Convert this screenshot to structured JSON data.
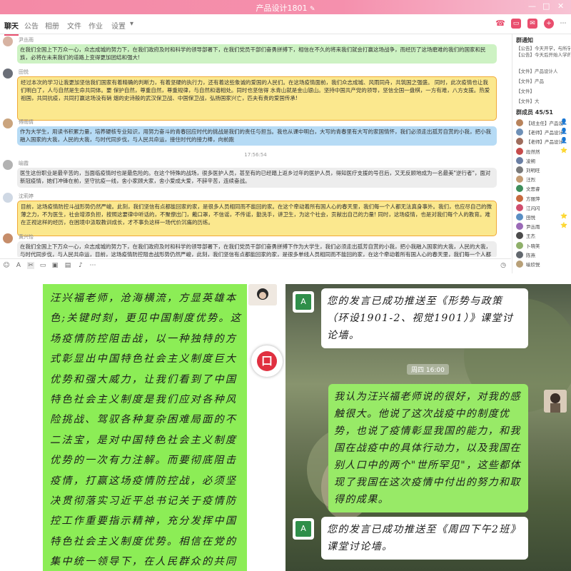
{
  "window": {
    "title": "产品设计1801",
    "edit_icon": "pencil-icon",
    "controls": [
      "—",
      "□",
      "✕"
    ]
  },
  "nav": {
    "tabs": [
      "聊天",
      "公告",
      "相册",
      "文件",
      "作业",
      "设置"
    ],
    "active_tab": "聊天",
    "settings_caret": "▾",
    "accent": "#e94e6e"
  },
  "messages": [
    {
      "name": "尹丛雨",
      "style": "green",
      "text": "在我们全国上下万众一心，众志成城的努力下，在我们政府及时和科学的领导部署下，在我们党员干部们奋勇拼搏下，相信在不久的将来我们就会打赢这场战争，而经历了这场磨难的我们的国家和民族，必将在未来我们的道路上变得更加团结和强大!"
    },
    {
      "name": "田悦",
      "style": "yellow",
      "text": "经过本次的学习让我更加坚信我们国家有着精确的判断力，有着坚硬的执行力，还有着这些象诚的爱国的人民们。在这场疫情面前，我们众志成城、风雨同舟，共筑国之强盛。 同时，此次疫情也让我们明白了，人与自然是生命共同体。要 保护自然，尊重自然，尊重规律，与自然和谐相处。同时也坚信得 水青山就是金山银山。坚持中国共产党的领导，坚信全国一盘棋，一方有难，八方支援。热爱祖国，共同抗疫，共同打赢这场没有硝 烟的史诗般的武汉保卫战、中国保卫战，弘扬国家兴亡，匹夫有责的爱国传承!"
    },
    {
      "name": "傅雨倩",
      "style": "blue",
      "text": "作为大学生，用读书积累力量，培养硬核专业知识，用努力奋斗的青春回应时代的挑战是我们的责任与担当。我也从课中明白，大写的青春里有大写的家国情怀，我们必须走出孤芳自赏的小我，把小我融入国家的大我，人民的大我，与时代同步伐，与人民共命运，接住时代的接力棒，向前跑"
    },
    {
      "name": "喻霞",
      "style": "gray",
      "text": "医生这份职业是最辛苦的，当面临疫情时也是最危险的。在这个特殊的战场，很多医护人员，甚至有的已经踏上返乡过年的医护人员，得知医疗支援的号召后，又无反顾地成为一名最美\"逆行者\"，面对新冠疫情，她们冲锋在前，坚守抗疫一线，舍小家顾大家，舍小爱成大爱，不辞辛苦，连续奋战。"
    },
    {
      "name": "沈莉婷",
      "style": "yellow",
      "text": "目前，这场疫情防控斗战形势仍然严峻。此刻，我们坚信有点都能回家的家，是很多人员相同而不能回的家。在这个牵动着所有国人心的春天里，我们每一个人都无法真身事外。我们，也应尽自己的微薄之力，不为医生，社会增添负担，按照这要律中听话的，不聚僚出门，戴口罩，不信谣，不传谣，勤洗手，讲卫生，为这个社会，贡献出自己的力量! 同时，这场疫情，也是对我们每个人的教育。难在正视这样的经历，在困境中汲取教训成长，才不事负这样一场代价沉痛的历练。"
    },
    {
      "name": "黄兴怡",
      "style": "gray",
      "text": "在我们全国上下万众一心，众志成城的努力下，在我们政府及时和科学的领导部署下，在我们党员干部们奋勇拼搏下作为大学生，我们必须走出孤芳自赏的小我，把小我融入国家的大我，人民的大我，与时代同步伐，与人民共命运，目前，这场疫情防控阻击战形势仍然严峻，此刻，我们坚信有点都能回家的家，是很多单线人员相同而不能回的家，在这个牵动着所有国人心的春天里，我们每一个人都无法真身事外。"
    }
  ],
  "timestamp": "17:56:54",
  "toolbar_icons": [
    "emoji-icon",
    "font-icon",
    "scissors-icon",
    "folder-icon",
    "image-icon",
    "gallery-icon",
    "bell-icon",
    "history-icon"
  ],
  "sidebar": {
    "notice_title": "群通知",
    "notices": [
      "【公告】今天",
      "年一",
      "布去，苗林市疫",
      "字，请老人里的",
      "【文件】产品设",
      "【文件】产品",
      "【文件】尹丛雨",
      "【文件】主",
      "【文件】大"
    ],
    "notice_lines": [
      "【公告】今天开学，与所学生",
      "【公告】今天后开始人学的通知,",
      "【文件】产品设计人",
      "【文件】产品",
      "【文件】",
      "【文件】大"
    ],
    "members_title": "群成员 45/51",
    "members": [
      {
        "name": "【班主任】产品设",
        "color": "#b8835b",
        "icon": "👤"
      },
      {
        "name": "【老师】产品设计",
        "color": "#6e90b7",
        "icon": "👤"
      },
      {
        "name": "【老师】产品设计",
        "color": "#9e6d5d",
        "icon": "👤"
      },
      {
        "name": "段然然",
        "color": "#c64b4b",
        "icon": "⭐"
      },
      {
        "name": "凌朔",
        "color": "#6a7fa4",
        "icon": ""
      },
      {
        "name": "刘明旺",
        "color": "#7a7a7a",
        "icon": ""
      },
      {
        "name": "汪烈",
        "color": "#c49b72",
        "icon": ""
      },
      {
        "name": "文思睿",
        "color": "#3f8f5c",
        "icon": ""
      },
      {
        "name": "方丽萍",
        "color": "#c76a3f",
        "icon": ""
      },
      {
        "name": "江闪闪",
        "color": "#d04e6e",
        "icon": ""
      },
      {
        "name": "田悦",
        "color": "#5a8fc4",
        "icon": "⭐"
      },
      {
        "name": "尹丛雨",
        "color": "#9a6ab7",
        "icon": "⭐"
      },
      {
        "name": "王杰",
        "color": "#4b4b4b",
        "icon": ""
      },
      {
        "name": "卜晓笑",
        "color": "#8fb06a",
        "icon": ""
      },
      {
        "name": "陈燕",
        "color": "#62686e",
        "icon": ""
      },
      {
        "name": "喻欣悦",
        "color": "#b8a078",
        "icon": ""
      }
    ]
  },
  "handwritten_note": "汪兴福老师，沧海横流，方显英雄本色;关键时刻，更见中国制度优势。这场疫情防控阻击战，以一种独特的方式彰显出中国特色社会主义制度巨大优势和强大威力，让我们看到了中国特色社会主义制度是我们应对各种风险挑战、驾驭各种复杂困难局面的不二法宝，是对中国特色社会主义制度优势的一次有力注解。而要彻底阻击疫情，打赢这场疫情防控战，必须坚决贯彻落实习近平总书记关于疫情防控工作重要指示精神，充分发挥中国特色社会主义制度优势。相信在党的集中统一领导下，在人民群众的共同努力下，一定能够打赢这场",
  "mobile_chat": {
    "notice_1": "您的发言已成功推送至《形势与政策（环设1901-2、视觉1901）》课堂讨论墙。",
    "time_chip": "周四 16:00",
    "my_message": "我认为汪兴福老师说的很好，对我的感触很大。他说了这次战疫中的制度优势，也说了疫情彰显我国的能力，和我国在战疫中的具体行动力，以及我国在别人口中的两个\"世所罕见\"，这些都体现了我国在这次疫情中付出的努力和取得的成果。",
    "notice_2": "您的发言已成功推送至《周四下午2班》课堂讨论墙。",
    "bot_glyph": "A",
    "fab_glyph": "口"
  }
}
